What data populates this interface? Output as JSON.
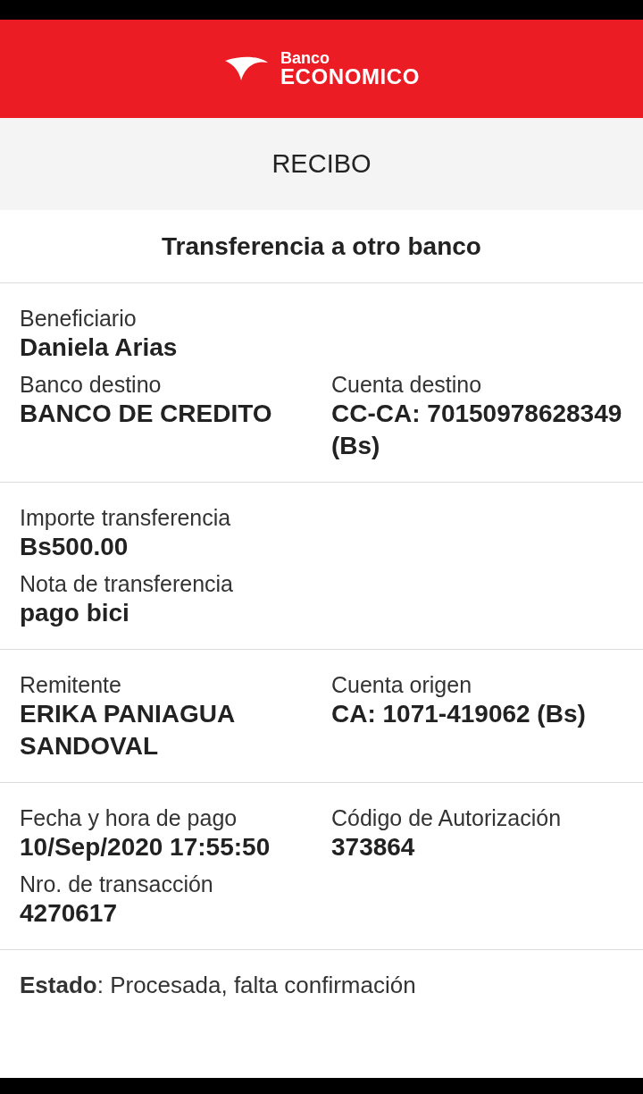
{
  "header": {
    "logo_top": "Banco",
    "logo_bottom": "ECONOMICO"
  },
  "title": "RECIBO",
  "subtitle": "Transferencia a otro banco",
  "sections": [
    {
      "rows": [
        [
          {
            "label": "Beneficiario",
            "value": "Daniela Arias"
          }
        ],
        [
          {
            "label": "Banco destino",
            "value": "BANCO DE CREDITO"
          },
          {
            "label": "Cuenta destino",
            "value": "CC-CA: 70150978628349 (Bs)"
          }
        ]
      ]
    },
    {
      "rows": [
        [
          {
            "label": "Importe transferencia",
            "value": "Bs500.00"
          }
        ],
        [
          {
            "label": "Nota de transferencia",
            "value": "pago bici"
          }
        ]
      ]
    },
    {
      "rows": [
        [
          {
            "label": "Remitente",
            "value": "ERIKA PANIAGUA SANDOVAL"
          },
          {
            "label": "Cuenta origen",
            "value": "CA: 1071-419062 (Bs)"
          }
        ]
      ]
    },
    {
      "rows": [
        [
          {
            "label": "Fecha y hora de pago",
            "value": "10/Sep/2020 17:55:50"
          },
          {
            "label": "Código de Autorización",
            "value": "373864"
          }
        ],
        [
          {
            "label": "Nro. de transacción",
            "value": "4270617"
          }
        ]
      ]
    }
  ],
  "status": "**Estado**: Procesada, falta confirmación"
}
